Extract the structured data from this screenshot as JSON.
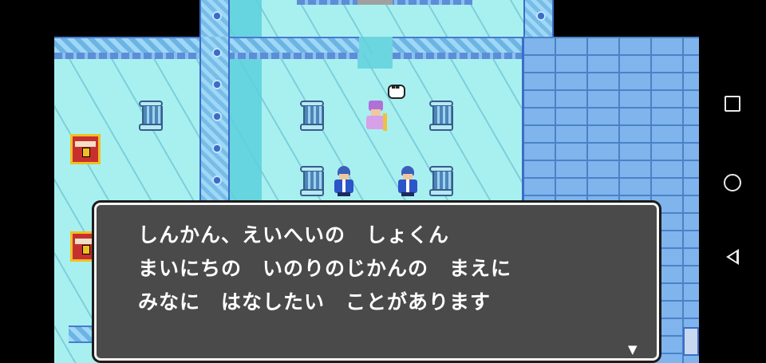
{
  "dialog": {
    "lines": [
      "しんかん、えいへいの　しょくん",
      "まいにちの　いのりのじかんの　まえに",
      "みなに　はなしたい　ことがあります"
    ],
    "continue_icon": "triangle-down-icon"
  },
  "navbar": {
    "buttons": [
      "recent-apps-icon",
      "home-icon",
      "back-icon"
    ]
  },
  "colors": {
    "dialog_bg": "#4a4a4a",
    "ice_floor": "#a8f0f0",
    "wall_blue": "#7fb4ec",
    "chest_red": "#c83030"
  }
}
